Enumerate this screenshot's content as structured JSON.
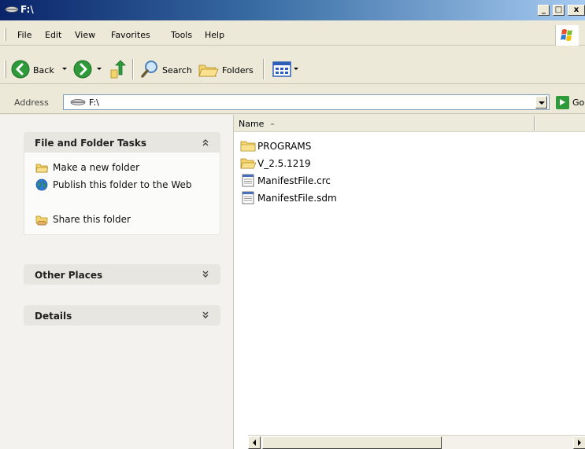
{
  "window": {
    "title": "F:\\",
    "controls": {
      "minimize": "_",
      "maximize": "□",
      "close": "x"
    }
  },
  "menu": {
    "items": [
      "File",
      "Edit",
      "View",
      "Favorites",
      "Tools",
      "Help"
    ]
  },
  "toolbar": {
    "back": "Back",
    "search": "Search",
    "folders": "Folders"
  },
  "address": {
    "label": "Address",
    "value": "F:\\",
    "go": "Go"
  },
  "tasks": {
    "file_folder": {
      "title": "File and Folder Tasks",
      "items": [
        {
          "label": "Make a new folder",
          "icon": "new-folder-icon"
        },
        {
          "label": "Publish this folder to the Web",
          "icon": "globe-icon"
        },
        {
          "label": "Share this folder",
          "icon": "share-folder-icon"
        }
      ]
    },
    "other_places": {
      "title": "Other Places"
    },
    "details": {
      "title": "Details"
    }
  },
  "files": {
    "column_name": "Name",
    "items": [
      {
        "name": "PROGRAMS",
        "type": "folder"
      },
      {
        "name": "V_2.5.1219",
        "type": "folder"
      },
      {
        "name": "ManifestFile.crc",
        "type": "file"
      },
      {
        "name": "ManifestFile.sdm",
        "type": "file"
      }
    ]
  },
  "colors": {
    "title_bar": "#0a246a",
    "task_pane": "#f4f2ef",
    "panel_header": "#e8e6e1",
    "folder": "#f3d36b"
  }
}
